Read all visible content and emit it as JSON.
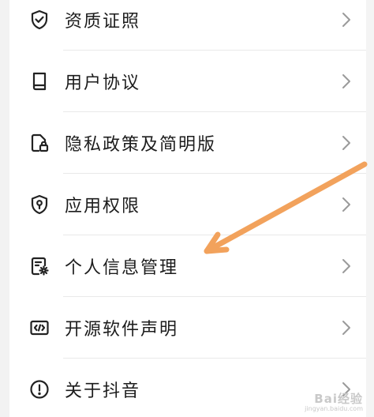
{
  "menu": {
    "items": [
      {
        "label": "资质证照",
        "icon": "shield-check-icon"
      },
      {
        "label": "用户协议",
        "icon": "book-icon"
      },
      {
        "label": "隐私政策及简明版",
        "icon": "document-lock-icon"
      },
      {
        "label": "应用权限",
        "icon": "shield-key-icon"
      },
      {
        "label": "个人信息管理",
        "icon": "document-gear-icon"
      },
      {
        "label": "开源软件声明",
        "icon": "code-icon"
      },
      {
        "label": "关于抖音",
        "icon": "info-icon"
      }
    ]
  },
  "annotation": {
    "arrow_color": "#f2a25c"
  },
  "watermark": {
    "logo": "Bai经验",
    "url": "jingyan.baidu.com"
  }
}
